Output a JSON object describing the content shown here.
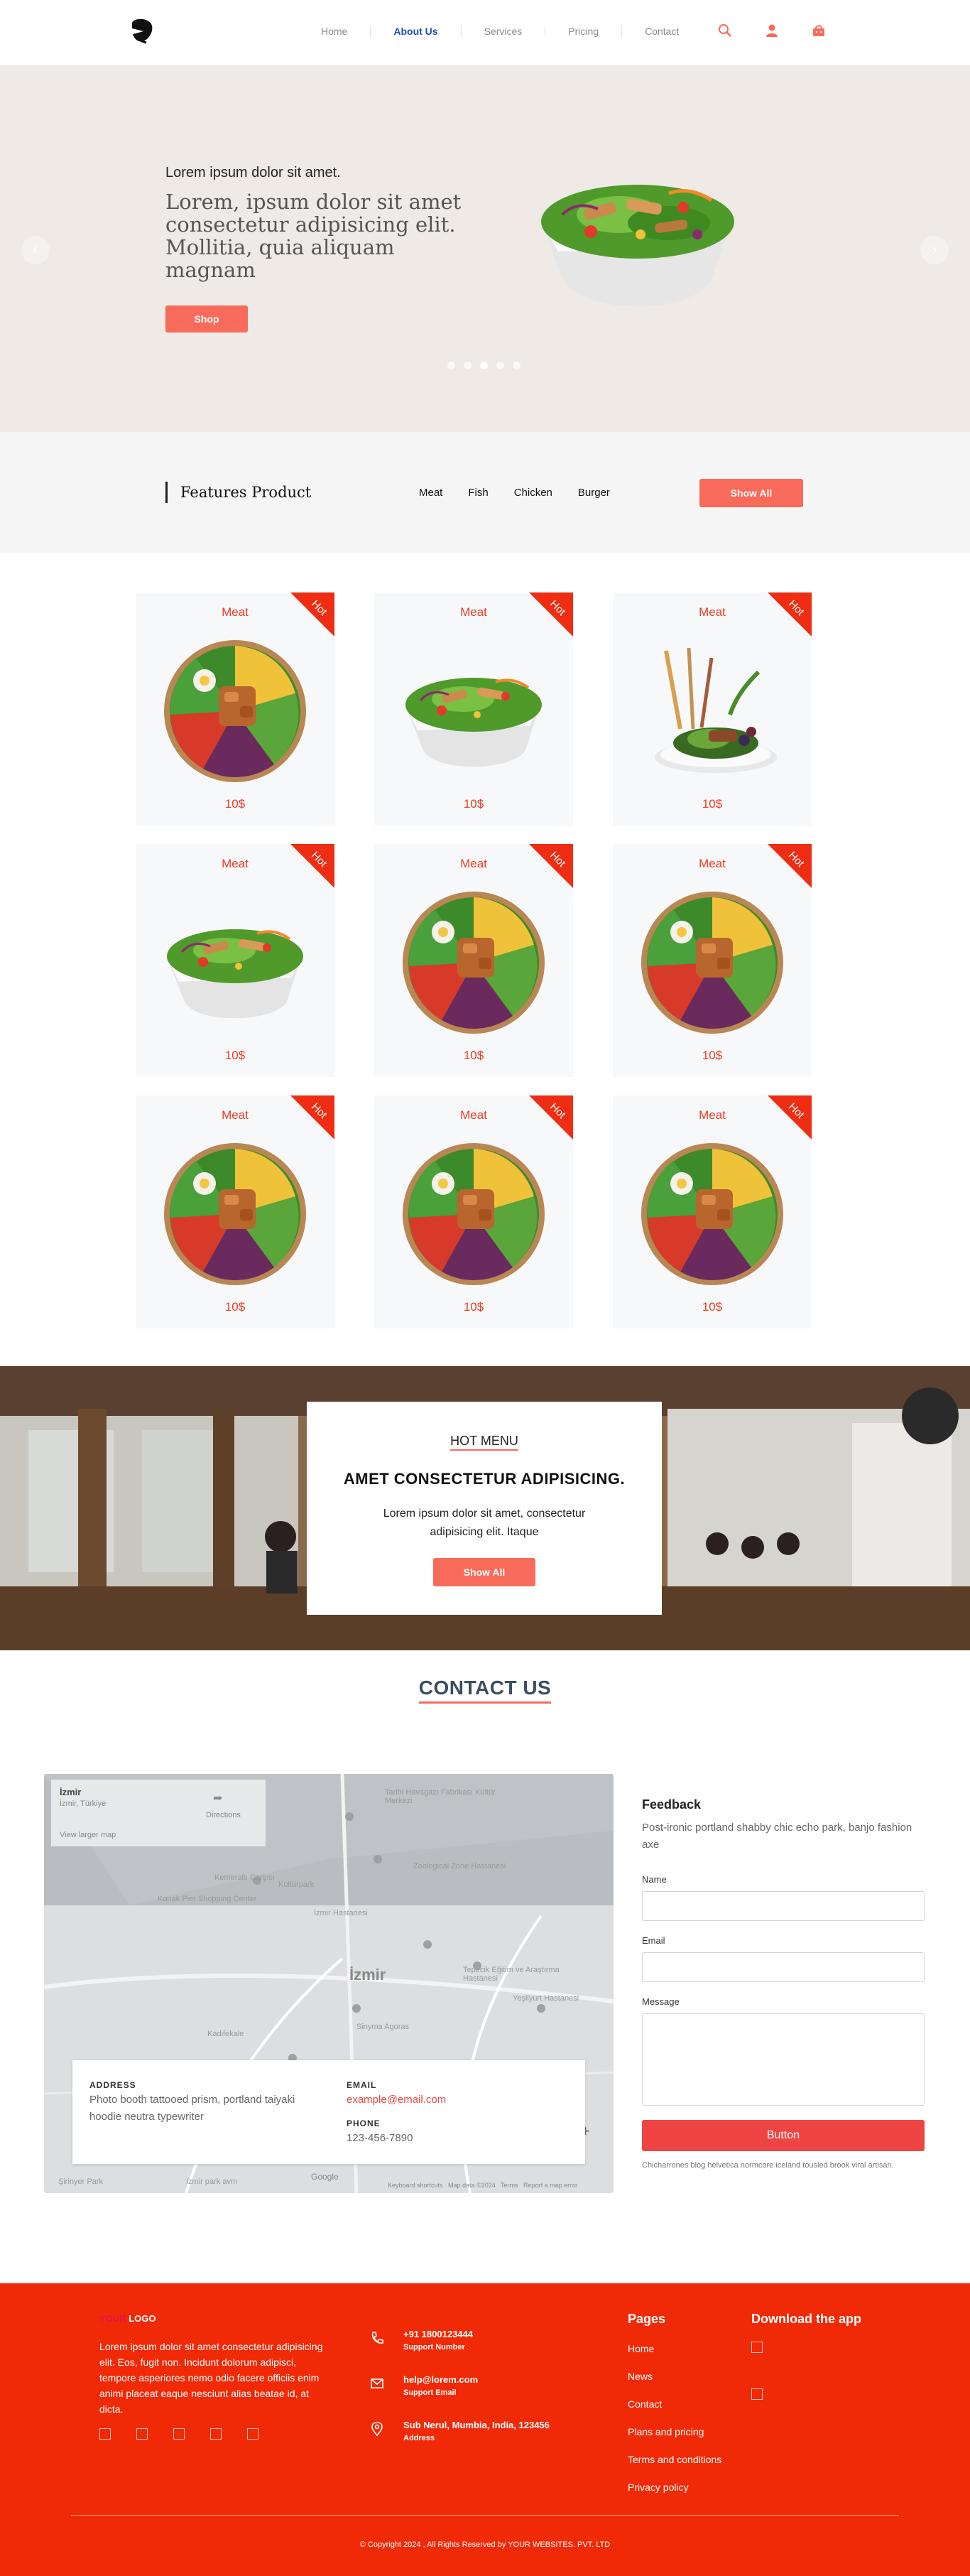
{
  "nav": {
    "links": [
      "Home",
      "About Us",
      "Services",
      "Pricing",
      "Contact"
    ],
    "active_index": 1,
    "icons": [
      "search-icon",
      "user-icon",
      "cart-icon"
    ],
    "accent": "#f86b5a",
    "active_color": "#1a4fb8"
  },
  "hero": {
    "kicker": "Lorem ipsum dolor sit amet.",
    "headline": "Lorem, ipsum dolor sit amet consectetur adipisicing elit. Mollitia, quia aliquam magnam",
    "button": "Shop",
    "slides": 5,
    "active_slide": 2
  },
  "features": {
    "title": "Features Product",
    "tabs": [
      "Meat",
      "Fish",
      "Chicken",
      "Burger"
    ],
    "show_all": "Show All"
  },
  "products": [
    {
      "category": "Meat",
      "badge": "Hot",
      "price": "10$",
      "image": "bowl"
    },
    {
      "category": "Meat",
      "badge": "Hot",
      "price": "10$",
      "image": "salad"
    },
    {
      "category": "Meat",
      "badge": "Hot",
      "price": "10$",
      "image": "plate"
    },
    {
      "category": "Meat",
      "badge": "Hot",
      "price": "10$",
      "image": "salad"
    },
    {
      "category": "Meat",
      "badge": "Hot",
      "price": "10$",
      "image": "bowl"
    },
    {
      "category": "Meat",
      "badge": "Hot",
      "price": "10$",
      "image": "bowl"
    },
    {
      "category": "Meat",
      "badge": "Hot",
      "price": "10$",
      "image": "bowl"
    },
    {
      "category": "Meat",
      "badge": "Hot",
      "price": "10$",
      "image": "bowl"
    },
    {
      "category": "Meat",
      "badge": "Hot",
      "price": "10$",
      "image": "bowl"
    }
  ],
  "hot_menu": {
    "label": "HOT MENU",
    "title": "AMET CONSECTETUR ADIPISICING.",
    "text": "Lorem ipsum dolor sit amet, consectetur adipisicing elit. Itaque",
    "button": "Show All"
  },
  "contact": {
    "title": "CONTACT US",
    "map": {
      "place": "İzmir",
      "region": "İzmir, Türkiye",
      "view_larger": "View larger map",
      "directions": "Directions",
      "city_label": "İzmir",
      "attribution": "Keyboard shortcuts   Map data ©2024   Terms   Report a map error",
      "google": "Google",
      "places": [
        "Tarihi Havagazı Fabrikası Kültür Merkezi",
        "Konak Pier Shopping Center",
        "Kemeraltı Çarşısı",
        "İzmir Hastanesi",
        "Zoological Zone Hastanesi",
        "Kültürpark",
        "Sinyma Agoras",
        "Kadifekale",
        "Tepecik Eğitim ve Araştırma Hastanesi",
        "Yeşilyurt Hastanesi",
        "İzmir park avm",
        "Şirinyer Park"
      ]
    },
    "address_label": "ADDRESS",
    "address": "Photo booth tattooed prism, portland taiyaki hoodie neutra typewriter",
    "email_label": "EMAIL",
    "email": "example@email.com",
    "phone_label": "PHONE",
    "phone": "123-456-7890"
  },
  "feedback": {
    "title": "Feedback",
    "description": "Post-ironic portland shabby chic echo park, banjo fashion axe",
    "name_label": "Name",
    "email_label": "Email",
    "message_label": "Message",
    "button": "Button",
    "note": "Chicharrones blog helvetica normcore iceland tousled brook viral artisan."
  },
  "footer": {
    "logo_prefix": "YOUR",
    "logo": "LOGO",
    "about": "Lorem ipsum dolor sit amet consectetur adipisicing elit. Eos, fugit non. Incidunt dolorum adipisci, tempore asperiores nemo odio facere officiis enim animi placeat eaque nesciunt alias beatae id, at dicta.",
    "social_icons": [
      "facebook-icon",
      "twitter-icon",
      "instagram-icon",
      "linkedin-icon",
      "youtube-icon"
    ],
    "contacts": [
      {
        "icon": "phone-icon",
        "main": "+91 1800123444",
        "sub": "Support Number"
      },
      {
        "icon": "mail-icon",
        "main": "help@lorem.com",
        "sub": "Support Email"
      },
      {
        "icon": "location-icon",
        "main": "Sub Nerul, Mumbia, India, 123456",
        "sub": "Address"
      }
    ],
    "pages_title": "Pages",
    "pages": [
      "Home",
      "News",
      "Contact",
      "Plans and pricing",
      "Terms and conditions",
      "Privacy policy"
    ],
    "download_title": "Download the app",
    "copyright": "© Copyright 2024 , All Rights Reserved by YOUR WEBSITES. PVT. LTD",
    "background": "#f02a07"
  }
}
